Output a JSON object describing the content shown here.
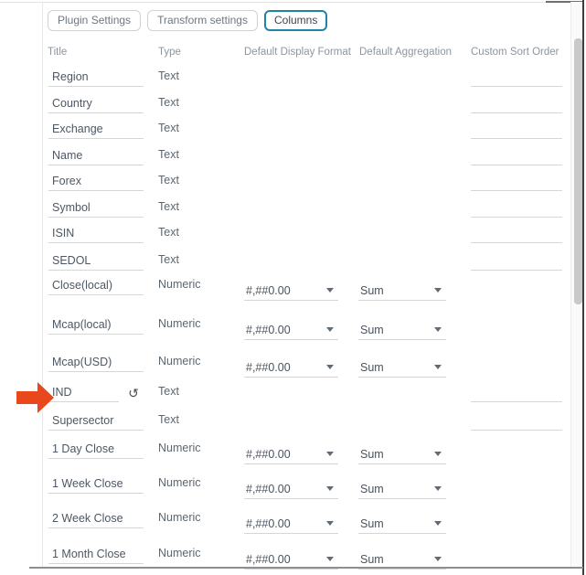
{
  "tabs": {
    "plugin": "Plugin Settings",
    "transform": "Transform settings",
    "columns": "Columns",
    "active_tab": "Columns"
  },
  "table": {
    "headers": {
      "title": "Title",
      "type": "Type",
      "format": "Default Display Format",
      "aggregation": "Default Aggregation",
      "sort": "Custom Sort Order"
    },
    "rows": [
      {
        "title": "Region",
        "type": "Text",
        "sort": ""
      },
      {
        "title": "Country",
        "type": "Text",
        "sort": ""
      },
      {
        "title": "Exchange",
        "type": "Text",
        "sort": ""
      },
      {
        "title": "Name",
        "type": "Text",
        "sort": ""
      },
      {
        "title": "Forex",
        "type": "Text",
        "sort": ""
      },
      {
        "title": "Symbol",
        "type": "Text",
        "sort": ""
      },
      {
        "title": "ISIN",
        "type": "Text",
        "sort": ""
      },
      {
        "title": "SEDOL",
        "type": "Text",
        "sort": ""
      },
      {
        "title": "Close(local)",
        "type": "Numeric",
        "format": "#,##0.00",
        "aggregation": "Sum"
      },
      {
        "title": "Mcap(local)",
        "type": "Numeric",
        "format": "#,##0.00",
        "aggregation": "Sum"
      },
      {
        "title": "Mcap(USD)",
        "type": "Numeric",
        "format": "#,##0.00",
        "aggregation": "Sum"
      },
      {
        "title": "IND",
        "type": "Text",
        "sort": "",
        "modified": true
      },
      {
        "title": "Supersector",
        "type": "Text",
        "sort": ""
      },
      {
        "title": "1 Day Close",
        "type": "Numeric",
        "format": "#,##0.00",
        "aggregation": "Sum"
      },
      {
        "title": "1 Week Close",
        "type": "Numeric",
        "format": "#,##0.00",
        "aggregation": "Sum"
      },
      {
        "title": "2 Week Close",
        "type": "Numeric",
        "format": "#,##0.00",
        "aggregation": "Sum"
      },
      {
        "title": "1 Month Close",
        "type": "Numeric",
        "format": "#,##0.00",
        "aggregation": "Sum"
      }
    ]
  },
  "icons": {
    "undo": "↺",
    "pointer_arrow_color": "#e8481c"
  },
  "colors": {
    "active_tab_border": "#1e86a4",
    "scrollbar_thumb": "#c9c9c9",
    "underline": "#d6d6d6"
  }
}
